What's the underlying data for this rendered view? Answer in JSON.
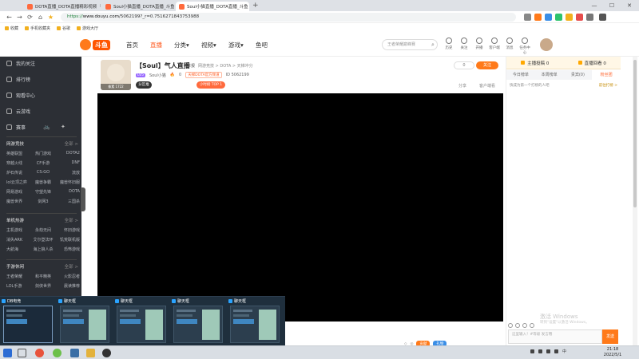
{
  "browser": {
    "tabs": [
      {
        "title": "DOTA直播_DOTA直播精彩视频",
        "active": false
      },
      {
        "title": "Soul小猫直播_DOTA直播_斗鱼",
        "active": false
      },
      {
        "title": "Soul小猫直播_DOTA直播_斗鱼",
        "active": true
      }
    ],
    "url_protocol": "https://",
    "url_host": "www.douyu.com",
    "url_path": "/5062199?_r=0.7516271843753988",
    "bookmarks": [
      "收藏",
      "手机收藏夹",
      "谷歌",
      "游戏大厅"
    ]
  },
  "site": {
    "logo_text": "斗鱼",
    "nav": [
      {
        "label": "首页",
        "active": false
      },
      {
        "label": "直播",
        "active": true
      },
      {
        "label": "分类▾",
        "active": false
      },
      {
        "label": "视频▾",
        "active": false
      },
      {
        "label": "游戏▾",
        "active": false
      },
      {
        "label": "鱼吧",
        "active": false
      }
    ],
    "search_placeholder": "王者荣耀巅峰赛",
    "header_icons": [
      {
        "label": "历史",
        "icon": "history-icon"
      },
      {
        "label": "关注",
        "icon": "follow-icon"
      },
      {
        "label": "开播",
        "icon": "broadcast-icon"
      },
      {
        "label": "客户端",
        "icon": "download-icon"
      },
      {
        "label": "消息",
        "icon": "message-icon"
      },
      {
        "label": "任务中心",
        "icon": "task-icon"
      }
    ]
  },
  "sidebar": {
    "items": [
      {
        "label": "我的关注",
        "icon": "heart-icon"
      },
      {
        "label": "排行榜",
        "icon": "rank-icon"
      },
      {
        "label": "观看中心",
        "icon": "watch-icon"
      },
      {
        "label": "云游戏",
        "icon": "cloud-game-icon"
      }
    ],
    "quick_icons": [
      {
        "label": "赛事",
        "icon": "match-icon"
      },
      {
        "label": "",
        "icon": "bike-icon"
      },
      {
        "label": "",
        "icon": "game-icon"
      }
    ],
    "sections": [
      {
        "title": "网游竞技",
        "more": "全部 >",
        "games": [
          "英雄联盟",
          "热门游戏",
          "DOTA2",
          "穿越火线",
          "CF手游",
          "DNF",
          "炉石传说",
          "CS:GO",
          "流放",
          "lol云顶之弈",
          "魔兽争霸",
          "魔兽怀旧服",
          "网易游戏",
          "守望先锋",
          "DOTA",
          "魔兽世界",
          "剑网3",
          "三国杀"
        ]
      },
      {
        "title": "单机热游",
        "more": "全部 >",
        "games": [
          "主机游戏",
          "永劫无间",
          "怀旧游戏",
          "消失ARK",
          "艾尔登法环",
          "饥荒联机版",
          "大航海",
          "海上狼人杀",
          "恐怖游戏"
        ]
      },
      {
        "title": "手游休闲",
        "more": "全部 >",
        "games": [
          "王者荣耀",
          "和平精英",
          "火影忍者",
          "LOL手游",
          "剑侠世界",
          "晨读推荐"
        ]
      }
    ]
  },
  "room": {
    "thumb_caption": "像素 1722",
    "title": "【Soul】气人直播",
    "category": "网游竞技 > DOTA > 天梯冲分",
    "category_label": "举报",
    "streamer": "Soul小猫",
    "level_badge": "LV5",
    "heat": "0",
    "tag": "天梯DOTA官方频道",
    "id_label": "ID 5062199",
    "rank_pill": "分区推",
    "rank_pill2": "小时榜 TOP 1",
    "follow_label": "关注",
    "follow_count": "0",
    "share_label": "分享",
    "report_label": "客户端看"
  },
  "chat": {
    "top": [
      {
        "label": "主播投稿 0"
      },
      {
        "label": "直播回看 0"
      }
    ],
    "tabs": [
      {
        "label": "今日榜单",
        "on": false
      },
      {
        "label": "本周榜单",
        "on": false
      },
      {
        "label": "贵宾(0)",
        "on": false
      },
      {
        "label": "粉丝团",
        "on": true
      }
    ],
    "notice": "快成为第一个打榜的人吧",
    "notice_right": "前往打榜 >",
    "input_placeholder": "这里输入！#等级 发言哦",
    "send_label": "发送"
  },
  "watermark": {
    "line1": "激活 Windows",
    "line2": "转到\"设置\"以激活 Windows。"
  },
  "gifts": {
    "orange": "贡献",
    "blue": "礼物"
  },
  "task_thumbs": [
    {
      "title": "DB电竞",
      "active": true
    },
    {
      "title": "聊天框",
      "active": false
    },
    {
      "title": "聊天框",
      "active": false
    },
    {
      "title": "聊天框",
      "active": false
    },
    {
      "title": "聊天框",
      "active": false
    }
  ],
  "clock": {
    "time": "21:18",
    "date": "2022/5/1"
  },
  "tray_lang": "中"
}
